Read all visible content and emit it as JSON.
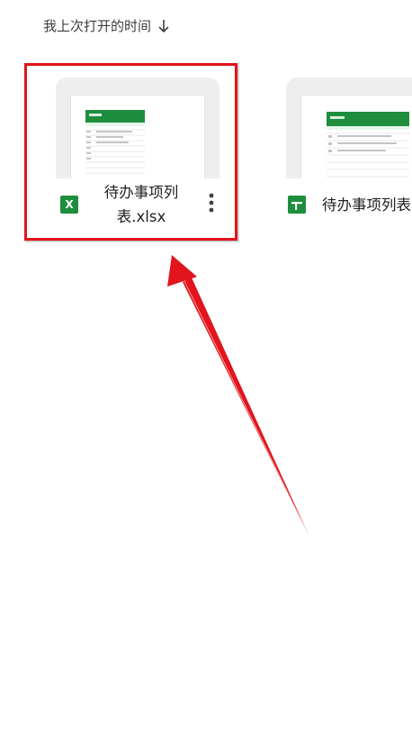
{
  "sort": {
    "label": "我上次打开的时间"
  },
  "files": [
    {
      "name": "待办事项列表.xlsx",
      "name_line1": "待办事项列",
      "name_line2": "表.xlsx",
      "type_icon": "excel-icon",
      "type_letter": "X"
    },
    {
      "name": "待办事项列表",
      "type_icon": "sheets-icon"
    }
  ],
  "colors": {
    "accent_green": "#1e8e3e",
    "annotation_red": "#e2141c"
  }
}
